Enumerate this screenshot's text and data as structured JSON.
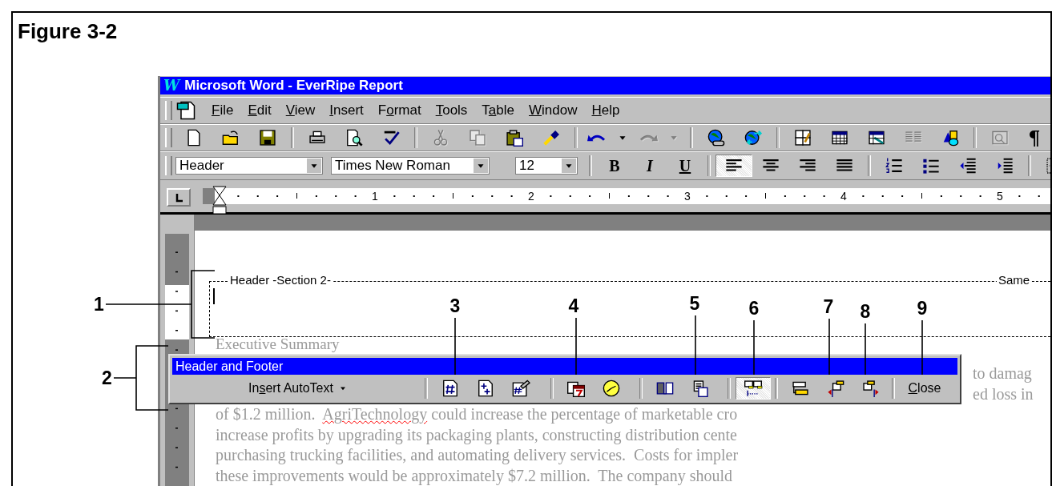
{
  "figure_title": "Figure 3-2",
  "window": {
    "logo": "W",
    "title": "Microsoft Word - EverRipe Report"
  },
  "menu": [
    {
      "key": "F",
      "post": "ile"
    },
    {
      "key": "E",
      "post": "dit"
    },
    {
      "key": "V",
      "post": "iew"
    },
    {
      "key": "I",
      "post": "nsert"
    },
    {
      "pre": "F",
      "key": "o",
      "post": "rmat"
    },
    {
      "key": "T",
      "post": "ools"
    },
    {
      "pre": "T",
      "key": "a",
      "post": "ble"
    },
    {
      "key": "W",
      "post": "indow"
    },
    {
      "key": "H",
      "post": "elp"
    }
  ],
  "standard_toolbar": {
    "buttons": [
      {
        "disabled": false
      },
      {
        "disabled": false
      },
      {
        "disabled": false
      },
      {
        "disabled": false
      },
      {
        "disabled": false
      },
      {
        "disabled": false
      },
      {
        "disabled": true
      },
      {
        "disabled": true
      },
      {
        "disabled": false
      },
      {
        "disabled": false
      },
      {
        "disabled": false
      },
      {
        "disabled": false
      },
      {
        "disabled": true
      },
      {
        "disabled": true
      },
      {
        "disabled": false
      },
      {
        "disabled": false
      },
      {
        "disabled": false
      },
      {
        "disabled": false
      },
      {
        "disabled": false
      },
      {
        "disabled": true
      },
      {
        "disabled": false
      },
      {
        "disabled": true
      }
    ],
    "show_marks": "¶"
  },
  "formatting_toolbar": {
    "style": "Header",
    "font": "Times New Roman",
    "size": "12",
    "bold": "B",
    "italic": "I",
    "underline": "U",
    "alignment": [
      {
        "selected": true
      },
      {
        "selected": false
      },
      {
        "selected": false
      },
      {
        "selected": false
      }
    ]
  },
  "ruler": {
    "numbers": [
      "1",
      "2",
      "3",
      "4",
      "5"
    ]
  },
  "header_area": {
    "label": "Header -Section 2-",
    "link_label": "Same"
  },
  "body_lines": [
    {
      "kind": "full",
      "segments": [
        {
          "text": "Executive Summary",
          "misspelled": false
        }
      ]
    },
    {
      "kind": "tail",
      "segments": [
        {
          "text": "to damag",
          "misspelled": false
        }
      ]
    },
    {
      "kind": "tail",
      "segments": [
        {
          "text": "ed loss in",
          "misspelled": false
        }
      ]
    },
    {
      "kind": "full",
      "segments": [
        {
          "text": "of $1.2 million.  ",
          "misspelled": false
        },
        {
          "text": "AgriTechnology",
          "misspelled": true
        },
        {
          "text": " could increase the percentage of marketable cro",
          "misspelled": false
        }
      ]
    },
    {
      "kind": "full",
      "segments": [
        {
          "text": "increase profits by upgrading its packaging plants, constructing distribution cente",
          "misspelled": false
        }
      ]
    },
    {
      "kind": "full",
      "segments": [
        {
          "text": "purchasing trucking facilities, and automating delivery services.  Costs for impler",
          "misspelled": false
        }
      ]
    },
    {
      "kind": "full",
      "segments": [
        {
          "text": "these improvements would be approximately $7.2 million.  The company should",
          "misspelled": false
        }
      ]
    }
  ],
  "header_footer_toolbar": {
    "title": "Header and Footer",
    "autotext": {
      "pre": "In",
      "key": "s",
      "post": "ert AutoText"
    },
    "buttons": [
      {
        "on": false
      },
      {
        "on": false
      },
      {
        "on": false
      },
      {
        "on": false
      },
      {
        "on": false
      },
      {
        "on": false
      },
      {
        "on": false
      },
      {
        "on": true
      },
      {
        "on": false
      },
      {
        "on": false
      },
      {
        "on": false
      }
    ],
    "close": {
      "key": "C",
      "post": "lose"
    }
  },
  "callouts": [
    "1",
    "2",
    "3",
    "4",
    "5",
    "6",
    "7",
    "8",
    "9"
  ]
}
